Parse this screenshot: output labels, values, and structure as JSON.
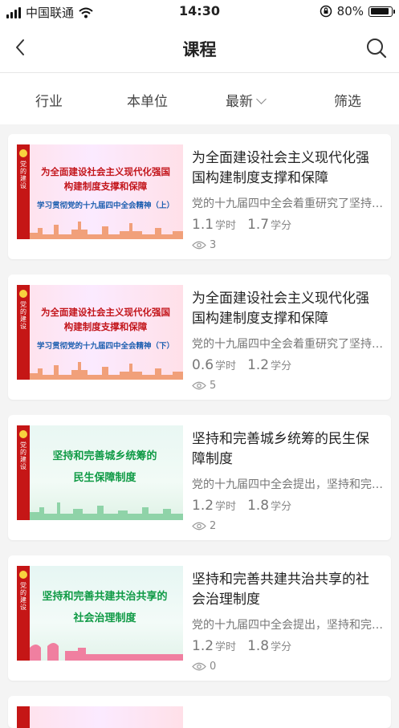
{
  "status_bar": {
    "carrier": "中国联通",
    "time": "14:30",
    "battery": "80%"
  },
  "nav": {
    "title": "课程"
  },
  "filters": {
    "industry": "行业",
    "unit": "本单位",
    "latest": "最新",
    "screen": "筛选"
  },
  "thumb_strip_label": "党的建设",
  "courses": [
    {
      "title": "为全面建设社会主义现代化强国构建制度支撑和保障",
      "thumb_line1": "为全面建设社会主义现代化强国",
      "thumb_line2": "构建制度支撑和保障",
      "thumb_sub": "学习贯彻党的十九届四中全会精神（上）",
      "desc": "党的十九届四中全会着重研究了坚持和完善中国特色社会主义制度",
      "hours": "1.1",
      "hours_unit": "学时",
      "credits": "1.7",
      "credits_unit": "学分",
      "views": "3"
    },
    {
      "title": "为全面建设社会主义现代化强国构建制度支撑和保障",
      "thumb_line1": "为全面建设社会主义现代化强国",
      "thumb_line2": "构建制度支撑和保障",
      "thumb_sub": "学习贯彻党的十九届四中全会精神（下）",
      "desc": "党的十九届四中全会着重研究了坚持和完善中国特色社会主义制度",
      "hours": "0.6",
      "hours_unit": "学时",
      "credits": "1.2",
      "credits_unit": "学分",
      "views": "5"
    },
    {
      "title": "坚持和完善城乡统筹的民生保障制度",
      "thumb_line1": "坚持和完善城乡统筹的",
      "thumb_line2": "民生保障制度",
      "desc": "党的十九届四中全会提出，坚持和完善统筹城乡的民生保障制度",
      "hours": "1.2",
      "hours_unit": "学时",
      "credits": "1.8",
      "credits_unit": "学分",
      "views": "2"
    },
    {
      "title": "坚持和完善共建共治共享的社会治理制度",
      "thumb_line1": "坚持和完善共建共治共享的",
      "thumb_line2": "社会治理制度",
      "desc": "党的十九届四中全会提出，坚持和完善共建共治共享的社会治理制度",
      "hours": "1.2",
      "hours_unit": "学时",
      "credits": "1.8",
      "credits_unit": "学分",
      "views": "0"
    }
  ]
}
